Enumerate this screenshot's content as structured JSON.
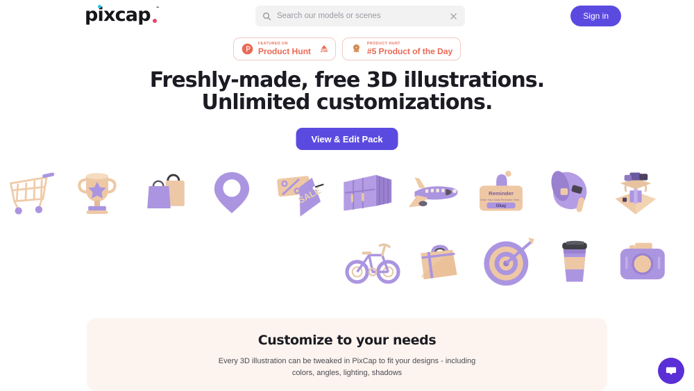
{
  "header": {
    "logo_text": "pixcap",
    "logo_tm": "••",
    "search": {
      "placeholder": "Search our models or scenes",
      "value": "",
      "icon": "search-icon",
      "clear_icon": "close-icon"
    },
    "signin_label": "Sign in"
  },
  "badges": [
    {
      "icon": "product-hunt-logo-icon",
      "eyebrow": "FEATURED ON",
      "title": "Product Hunt",
      "vote_count": "258",
      "has_vote": true
    },
    {
      "icon": "product-hunt-medal-icon",
      "eyebrow": "PRODUCT HUNT",
      "title": "#5 Product of the Day",
      "vote_count": "",
      "has_vote": false
    }
  ],
  "hero": {
    "line1": "Freshly-made, free 3D illustrations.",
    "line2": "Unlimited customizations.",
    "cta_label": "View & Edit Pack"
  },
  "gallery": {
    "row1": [
      {
        "name": "shopping-cart-illustration",
        "label": "Shopping cart"
      },
      {
        "name": "trophy-illustration",
        "label": "Trophy"
      },
      {
        "name": "shopping-bags-illustration",
        "label": "Shopping bags"
      },
      {
        "name": "location-pin-illustration",
        "label": "Location pin"
      },
      {
        "name": "sale-tag-illustration",
        "label": "Sale tag"
      },
      {
        "name": "shipping-container-illustration",
        "label": "Shipping container"
      },
      {
        "name": "airplane-illustration",
        "label": "Airplane"
      },
      {
        "name": "reminder-card-illustration",
        "label": "Reminder"
      },
      {
        "name": "megaphone-illustration",
        "label": "Megaphone"
      },
      {
        "name": "gift-box-illustration",
        "label": "Gift box"
      },
      {
        "name": "partial-illustration",
        "label": ""
      }
    ],
    "row2": [
      {
        "name": "bicycle-illustration",
        "label": "Bicycle"
      },
      {
        "name": "delivery-bag-illustration",
        "label": "Delivery bag"
      },
      {
        "name": "target-dartboard-illustration",
        "label": "Target"
      },
      {
        "name": "coffee-cup-illustration",
        "label": "Coffee cup"
      },
      {
        "name": "camera-illustration",
        "label": "Camera"
      },
      {
        "name": "partial-illustration-2",
        "label": ""
      }
    ],
    "reminder_card": {
      "title": "Reminder",
      "body": "Enter Your Daily Reminder Here...",
      "button": "Okay"
    },
    "sale_tag_text": "SALE"
  },
  "promo": {
    "title": "Customize to your needs",
    "description": "Every 3D illustration can be tweaked in PixCap to fit your designs - including colors, angles, lighting, shadows"
  },
  "chat": {
    "icon": "chat-bubble-icon",
    "label": "Open chat"
  },
  "colors": {
    "accent_purple": "#5b4ae0",
    "chat_purple": "#5b2fd6",
    "badge_orange": "#ea6a55",
    "promo_bg": "#fdf4ef",
    "logo_cyan": "#22c6e8",
    "logo_pink": "#e8446b",
    "illus_purple": "#ab95e0",
    "illus_peach": "#f0c9a8"
  }
}
